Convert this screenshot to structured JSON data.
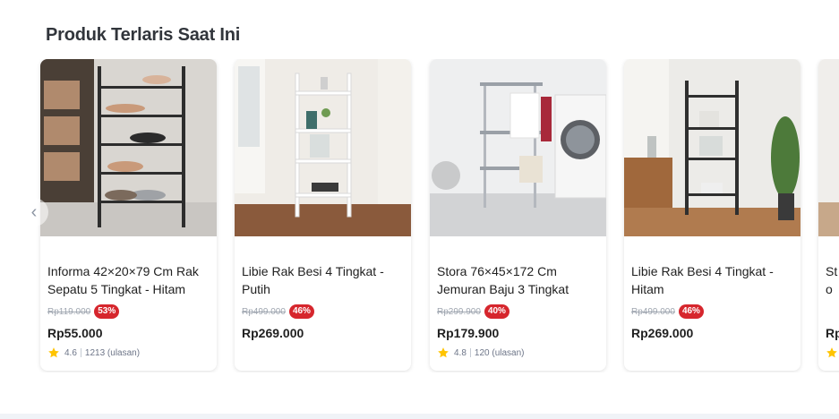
{
  "section": {
    "title": "Produk Terlaris Saat Ini"
  },
  "carousel": {
    "prev_icon": "chevron-left-icon"
  },
  "products": [
    {
      "name": "Informa 42×20×79 Cm Rak Sepatu 5 Tingkat - Hitam",
      "original_price": "Rp119.000",
      "discount": "53%",
      "price": "Rp55.000",
      "rating": "4.6",
      "reviews": "1213 (ulasan)"
    },
    {
      "name": "Libie Rak Besi 4 Tingkat - Putih",
      "original_price": "Rp499.000",
      "discount": "46%",
      "price": "Rp269.000"
    },
    {
      "name": "Stora 76×45×172 Cm Jemuran Baju 3 Tingkat",
      "original_price": "Rp299.900",
      "discount": "40%",
      "price": "Rp179.900",
      "rating": "4.8",
      "reviews": "120 (ulasan)"
    },
    {
      "name": "Libie Rak Besi 4 Tingkat - Hitam",
      "original_price": "Rp499.000",
      "discount": "46%",
      "price": "Rp269.000"
    },
    {
      "name": "Sto Tin",
      "price": "Rp"
    }
  ],
  "colors": {
    "discount_badge": "#d6262d",
    "star": "#ffc400",
    "title": "#31353b"
  }
}
